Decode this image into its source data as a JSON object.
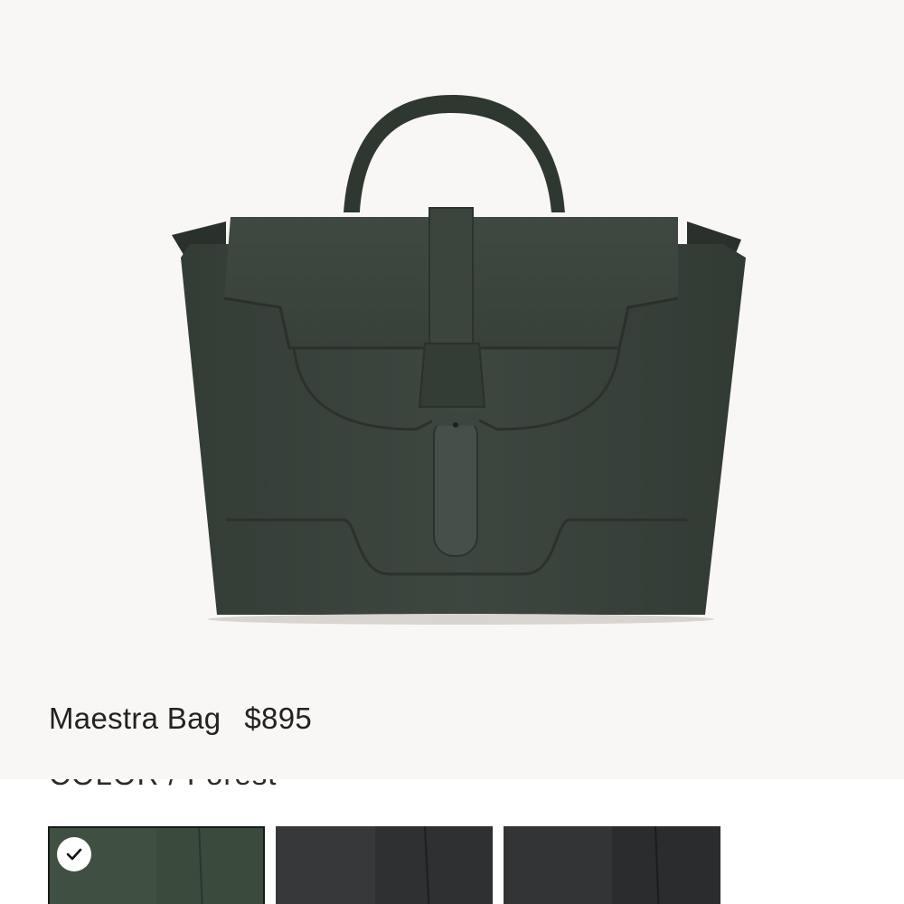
{
  "product": {
    "name": "Maestra Bag",
    "price": "$895",
    "image_icon": "leather-bag-image"
  },
  "color": {
    "label": "COLOR / Forest",
    "selected_index": 0,
    "swatches": [
      {
        "name": "Forest",
        "color": "#3a4a3c",
        "selected": true
      },
      {
        "name": "",
        "color": "#2e3031",
        "selected": false
      },
      {
        "name": "",
        "color": "#2b2c2e",
        "selected": false
      }
    ]
  },
  "colors": {
    "panel_background": "#f9f7f5",
    "bag_leather": "#3c453e",
    "text": "#222222"
  }
}
